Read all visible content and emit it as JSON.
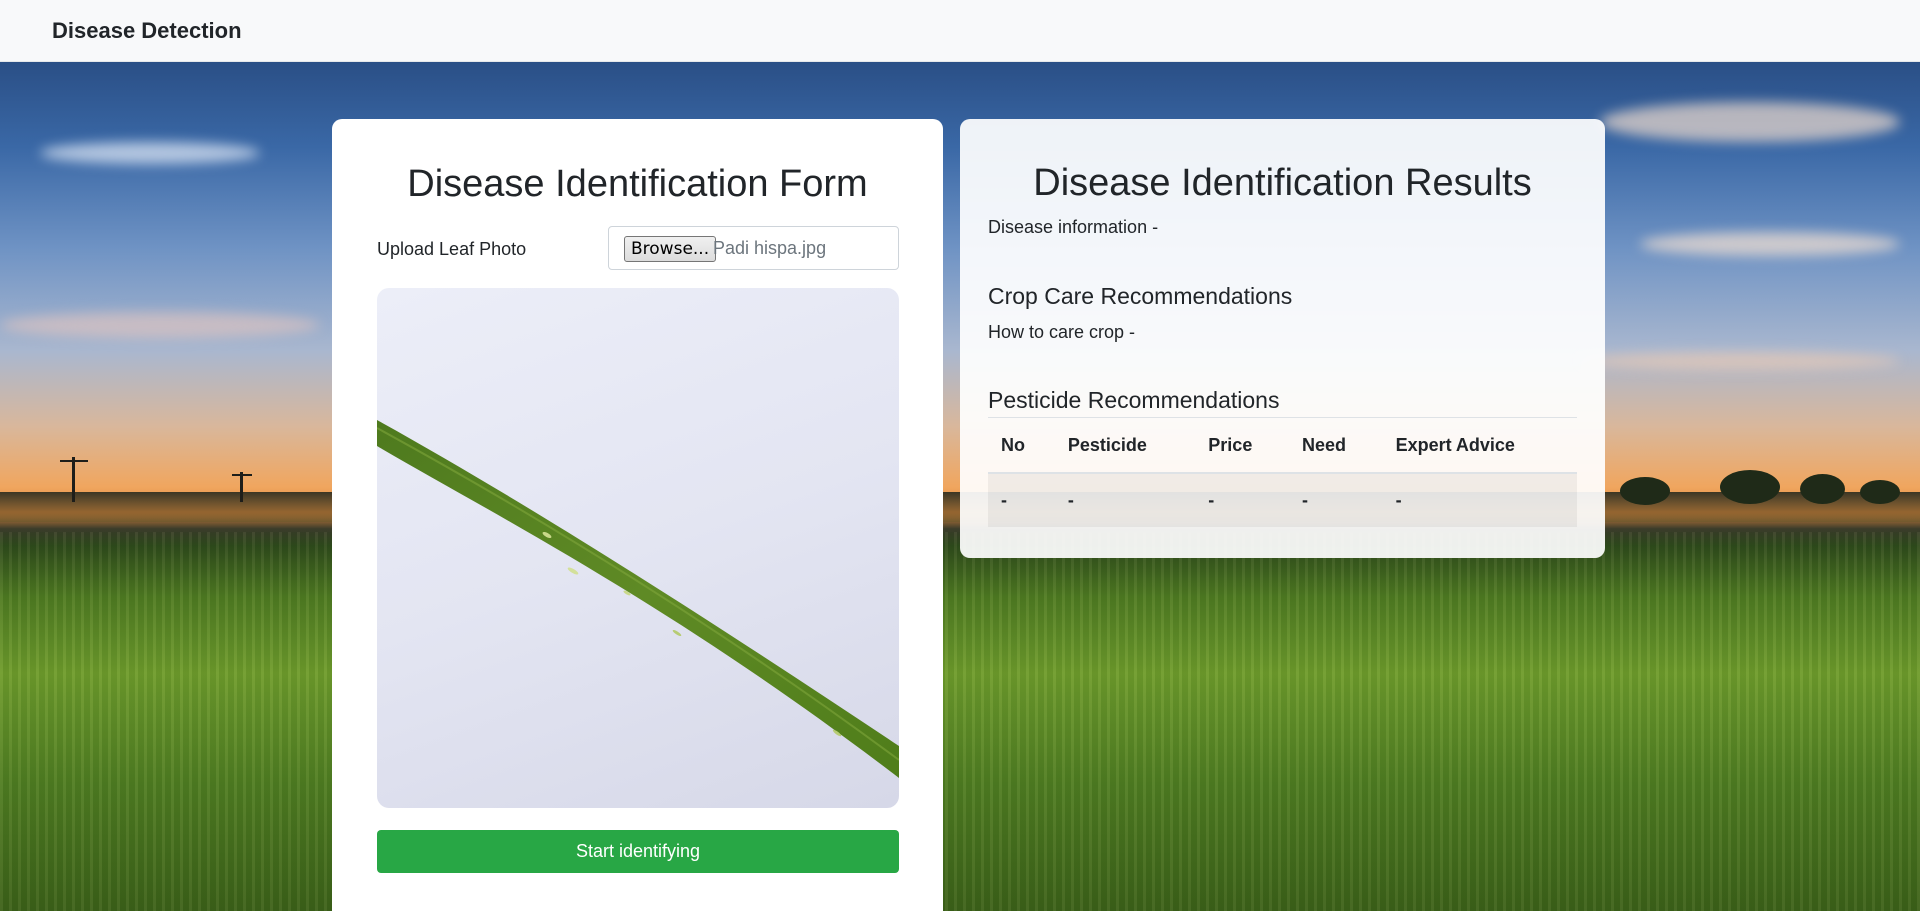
{
  "navbar": {
    "brand": "Disease Detection"
  },
  "form": {
    "title": "Disease Identification Form",
    "upload_label": "Upload Leaf Photo",
    "browse_label": "Browse...",
    "file_name": "Padi hispa.jpg",
    "start_button": "Start identifying"
  },
  "results": {
    "title": "Disease Identification Results",
    "disease_info": "Disease information -",
    "care_heading": "Crop Care Recommendations",
    "care_text": "How to care crop -",
    "pesticide_heading": "Pesticide Recommendations",
    "table": {
      "headers": [
        "No",
        "Pesticide",
        "Price",
        "Need",
        "Expert Advice"
      ],
      "rows": [
        [
          "-",
          "-",
          "-",
          "-",
          "-"
        ]
      ]
    }
  },
  "colors": {
    "primary_button": "#28a745",
    "navbar_bg": "#f8f9fa"
  }
}
